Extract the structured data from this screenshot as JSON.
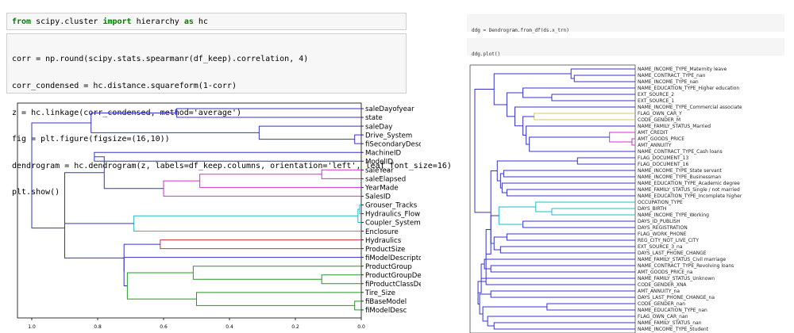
{
  "left_notebook": {
    "import_cell": {
      "kw_from": "from",
      "module": "scipy.cluster",
      "kw_import": "import",
      "name": "hierarchy",
      "kw_as": "as",
      "alias": "hc"
    },
    "code_cell": {
      "lines": [
        "corr = np.round(scipy.stats.spearmanr(df_keep).correlation, 4)",
        "corr_condensed = hc.distance.squareform(1-corr)",
        "z = hc.linkage(corr_condensed, method='average')",
        "fig = plt.figure(figsize=(16,10))",
        "dendrogram = hc.dendrogram(z, labels=df_keep.columns, orientation='left', leaf_font_size=16)",
        "plt.show()"
      ]
    }
  },
  "right_notebook": {
    "cell1": "ddg = Dendrogram.from_df(ds.x_trn)",
    "cell2": "ddg.plot()"
  },
  "colors": {
    "blue": "#3333cc",
    "magenta": "#cc33cc",
    "cyan": "#22bbcc",
    "red": "#cc3333",
    "green": "#229922",
    "yellow": "#cccc66"
  },
  "chart_data": [
    {
      "type": "dendrogram",
      "orientation": "left",
      "xlim": [
        1.0,
        0.0
      ],
      "xticks": [
        "1.0",
        "0.8",
        "0.6",
        "0.4",
        "0.2",
        "0.0"
      ],
      "leaves": [
        "saleDayofyear",
        "state",
        "saleDay",
        "Drive_System",
        "fiSecondaryDesc",
        "MachineID",
        "ModelID",
        "saleYear",
        "saleElapsed",
        "YearMade",
        "SalesID",
        "Grouser_Tracks",
        "Hydraulics_Flow",
        "Coupler_System",
        "Enclosure",
        "Hydraulics",
        "ProductSize",
        "fiModelDescriptor",
        "ProductGroup",
        "ProductGroupDesc",
        "fiProductClassDesc",
        "Tire_Size",
        "fiBaseModel",
        "fiModelDesc"
      ]
    },
    {
      "type": "dendrogram",
      "orientation": "left",
      "leaves": [
        "NAME_INCOME_TYPE_Maternity leave",
        "NAME_CONTRACT_TYPE_nan",
        "NAME_INCOME_TYPE_nan",
        "NAME_EDUCATION_TYPE_Higher education",
        "EXT_SOURCE_2",
        "EXT_SOURCE_1",
        "NAME_INCOME_TYPE_Commercial associate",
        "FLAG_OWN_CAR_Y",
        "CODE_GENDER_M",
        "NAME_FAMILY_STATUS_Married",
        "AMT_CREDIT",
        "AMT_GOODS_PRICE",
        "AMT_ANNUITY",
        "NAME_CONTRACT_TYPE_Cash loans",
        "FLAG_DOCUMENT_13",
        "FLAG_DOCUMENT_16",
        "NAME_INCOME_TYPE_State servant",
        "NAME_INCOME_TYPE_Businessman",
        "NAME_EDUCATION_TYPE_Academic degree",
        "NAME_FAMILY_STATUS_Single / not married",
        "NAME_EDUCATION_TYPE_Incomplete higher",
        "OCCUPATION_TYPE",
        "DAYS_BIRTH",
        "NAME_INCOME_TYPE_Working",
        "DAYS_ID_PUBLISH",
        "DAYS_REGISTRATION",
        "FLAG_WORK_PHONE",
        "REG_CITY_NOT_LIVE_CITY",
        "EXT_SOURCE_3_na",
        "DAYS_LAST_PHONE_CHANGE",
        "NAME_FAMILY_STATUS_Civil marriage",
        "NAME_CONTRACT_TYPE_Revolving loans",
        "AMT_GOODS_PRICE_na",
        "NAME_FAMILY_STATUS_Unknown",
        "CODE_GENDER_XNA",
        "AMT_ANNUITY_na",
        "DAYS_LAST_PHONE_CHANGE_na",
        "CODE_GENDER_nan",
        "NAME_EDUCATION_TYPE_nan",
        "FLAG_OWN_CAR_nan",
        "NAME_FAMILY_STATUS_nan",
        "NAME_INCOME_TYPE_Student"
      ]
    }
  ]
}
